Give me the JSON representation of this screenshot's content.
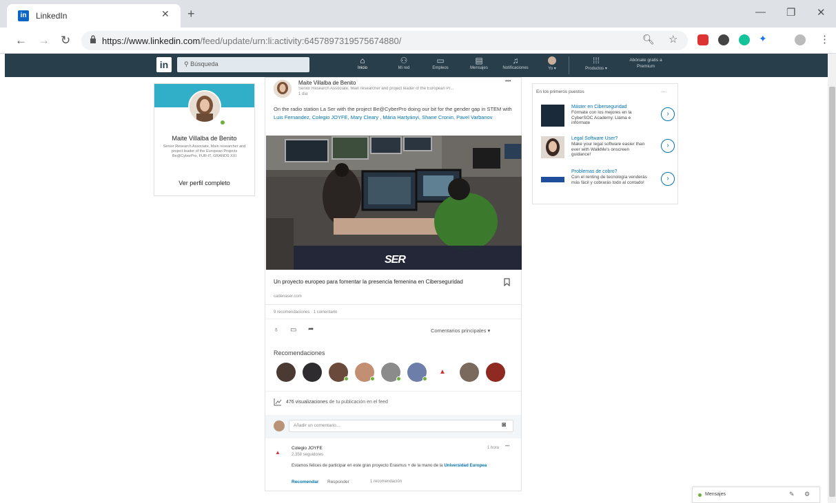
{
  "browser": {
    "tab_title": "LinkedIn",
    "url_host": "https://www.linkedin.com",
    "url_path": "/feed/update/urn:li:activity:6457897319575674880/"
  },
  "nav": {
    "search_placeholder": "Búsqueda",
    "items": [
      {
        "label": "Inicio",
        "icon": "home-icon"
      },
      {
        "label": "Mi red",
        "icon": "network-icon"
      },
      {
        "label": "Empleos",
        "icon": "briefcase-icon"
      },
      {
        "label": "Mensajes",
        "icon": "chat-icon"
      },
      {
        "label": "Notificaciones",
        "icon": "bell-icon"
      },
      {
        "label": "Yo ▾",
        "icon": "avatar"
      }
    ],
    "products": "Productos ▾",
    "premium": "Abónate gratis a Premium"
  },
  "profile": {
    "name": "Maite Villalba de Benito",
    "bio": "Senior Research Associate, Main researcher and project leader of the European Projects Be@CyberPro, FUR-IT, GRANDS XXI",
    "view_profile": "Ver perfil completo"
  },
  "post": {
    "author": "Maite Villalba de Benito",
    "headline": "Senior Research Associate, Main researcher and project leader of the European Pr...",
    "time": "1 día",
    "menu": "•••",
    "text_plain": "On the radio station La Ser with the project Be@CyberPro doing our bit for the gender gap in STEM with",
    "mentions": "Luis Fernandez, Colegio JOYFE, Mary Cleary , Mária Hartyányi, Shane Cronin, Pavel Varbanov",
    "image_logo": "SER",
    "link_title": "Un proyecto europeo para fomentar la presencia femenina en Ciberseguridad",
    "link_source": "cadenaser.com",
    "social_counts": "9 recomendaciones · 1 comentario",
    "sort_label": "Comentarios principales",
    "recommendations_title": "Recomendaciones",
    "views_count": "476 visualizaciones",
    "views_suffix": "de tu publicación en el feed",
    "comment_placeholder": "Añadir un comentario..."
  },
  "comment": {
    "author": "Colegio JOYFE",
    "followers": "2.358 seguidores",
    "time": "1 hora",
    "menu": "•••",
    "text": "Estamos felices de participar en este gran proyecto Erasmus + de la mano de la",
    "link": "Universidad Europea",
    "like": "Recomendar",
    "reply": "Responder",
    "likes": "1 recomendación"
  },
  "sidebar_ads": {
    "header": "En los primeros puestos",
    "menu": "...",
    "items": [
      {
        "title": "Máster en Ciberseguridad",
        "text": "Fórmate con los mejores en la CyberSOC Academy. Llama e infórmate"
      },
      {
        "title": "Legal Software User?",
        "text": "Make your legal software easier than ever with WalkMe's onscreen guidance!"
      },
      {
        "title": "Problemas de cobro?",
        "text": "Con el renting de tecnología venderás más fácil y cobrarás todo al contado!"
      }
    ]
  },
  "messaging": {
    "label": "Mensajes"
  }
}
